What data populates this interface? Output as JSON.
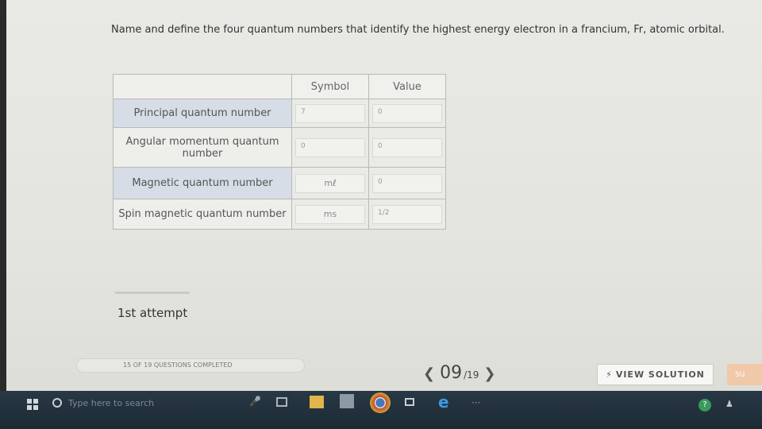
{
  "question": "Name and define the four quantum numbers that identify the highest energy electron in a francium, Fr, atomic orbital.",
  "table": {
    "headers": [
      "Symbol",
      "Value"
    ],
    "rows": [
      {
        "label": "Principal quantum number",
        "symbol": "7",
        "value": "0"
      },
      {
        "label": "Angular momentum quantum number",
        "symbol": "0",
        "value": "0"
      },
      {
        "label": "Magnetic quantum number",
        "symbol": "mℓ",
        "value": "0"
      },
      {
        "label": "Spin magnetic quantum number",
        "symbol": "ms",
        "value": "1/2"
      }
    ]
  },
  "attempt": "1st attempt",
  "progress_text": "15 OF 19 QUESTIONS COMPLETED",
  "progress": {
    "completed": 15,
    "total": 19
  },
  "pager": {
    "current": "09",
    "total": "/19"
  },
  "view_solution": "VIEW SOLUTION",
  "next_label": "SU",
  "taskbar": {
    "search_placeholder": "Type here to search",
    "icons": [
      "windows-start-icon",
      "cortana-icon",
      "microphone-icon",
      "task-view-icon",
      "file-explorer-icon",
      "store-icon",
      "chrome-icon",
      "tablet-icon",
      "edge-icon",
      "network-icon",
      "help-icon",
      "people-icon"
    ]
  },
  "colors": {
    "accent": "#d6dde6",
    "taskbar": "#1c2a34"
  }
}
